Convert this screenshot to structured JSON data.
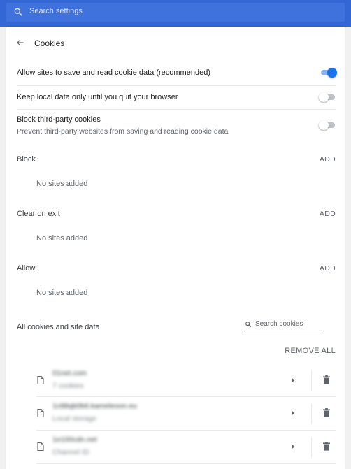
{
  "search": {
    "placeholder": "Search settings"
  },
  "page": {
    "title": "Cookies"
  },
  "settings": [
    {
      "label": "Allow sites to save and read cookie data (recommended)",
      "enabled": true
    },
    {
      "label": "Keep local data only until you quit your browser",
      "enabled": false
    },
    {
      "label": "Block third-party cookies",
      "sublabel": "Prevent third-party websites from saving and reading cookie data",
      "enabled": false
    }
  ],
  "sections": [
    {
      "title": "Block",
      "action": "ADD",
      "empty": "No sites added"
    },
    {
      "title": "Clear on exit",
      "action": "ADD",
      "empty": "No sites added"
    },
    {
      "title": "Allow",
      "action": "ADD",
      "empty": "No sites added"
    }
  ],
  "cookies": {
    "title": "All cookies and site data",
    "search_placeholder": "Search cookies",
    "remove_all": "REMOVE ALL",
    "sites": [
      {
        "name": "01net.com",
        "detail": "7 cookies"
      },
      {
        "name": "1c88qb0b6.kameleoon.eu",
        "detail": "Local storage"
      },
      {
        "name": "1e100cdn.net",
        "detail": "Channel ID"
      }
    ]
  },
  "colors": {
    "accent": "#1a73e8",
    "header": "#3367d6"
  }
}
